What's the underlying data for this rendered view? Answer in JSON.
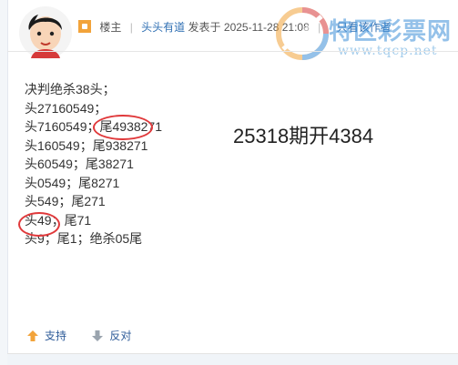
{
  "post": {
    "author_role": "楼主",
    "author_name": "头头有道",
    "posted_label": "发表于",
    "date": "2025-11-28 21:08",
    "view_author_only": "只看该作者"
  },
  "watermark": {
    "site_name": "特区彩票网",
    "url": "www.tqcp.net"
  },
  "content": {
    "lines": [
      "决判绝杀38头；",
      "头27160549；",
      "头7160549；尾4938271",
      "头160549；尾938271",
      "头60549；尾38271",
      "头0549；尾8271",
      "头549；尾271",
      "头49；尾71",
      "头9；尾1；绝杀05尾"
    ],
    "headline": "25318期开4384"
  },
  "actions": {
    "support": "支持",
    "oppose": "反对"
  },
  "colors": {
    "link_blue": "#2f6fb3",
    "circle_red": "#e0393b",
    "support_orange": "#f2a33a"
  },
  "icons": {
    "support": "arrow-up-icon",
    "oppose": "arrow-down-icon",
    "avatar": "cartoon-avatar-icon",
    "badge": "author-badge-icon",
    "watermark": "lottery-logo-icon"
  }
}
